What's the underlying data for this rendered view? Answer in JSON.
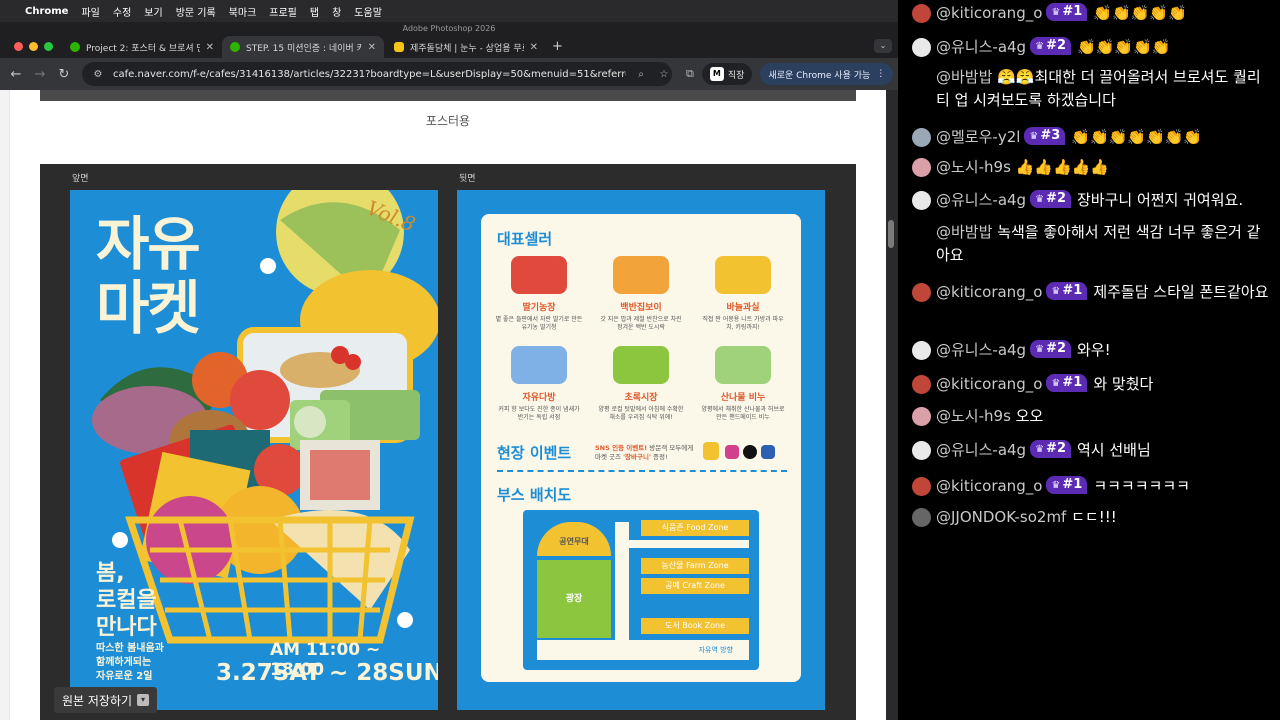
{
  "menubar": {
    "apple": "",
    "app": "Chrome",
    "items": [
      "파일",
      "수정",
      "보기",
      "방문 기록",
      "북마크",
      "프로필",
      "탭",
      "창",
      "도움말"
    ]
  },
  "ps_title": "Adobe Photoshop 2026",
  "tabs": [
    {
      "title": "Project 2: 포스터 & 브로셔 만들기",
      "active": false
    },
    {
      "title": "STEP. 15 미션인증 : 네이버 카페",
      "active": true
    },
    {
      "title": "제주돌담체 | 눈누 - 상업용 무료 한",
      "active": false
    }
  ],
  "toolbar": {
    "url": "cafe.naver.com/f-e/cafes/31416138/articles/32231?boardtype=L&userDisplay=50&menuid=51&referrerAllArticles...",
    "profile_label": "직장",
    "profile_badge": "M",
    "chrome_btn": "새로운 Chrome 사용 가능"
  },
  "page": {
    "caption": "포스터용",
    "front_label": "앞면",
    "back_label": "뒷면",
    "save_button": "원본 저장하기"
  },
  "poster_front": {
    "title_line1": "자유",
    "title_line2": "마켓",
    "vol": "Vol.8",
    "spring_line1": "봄,",
    "spring_line2": "로컬을",
    "spring_line3": "만나다",
    "sub_line1": "따스한 봄내음과",
    "sub_line2": "함께하게되는",
    "sub_line3": "자유로운 2일",
    "time": "AM 11:00 ~ 18:00",
    "date": "3.27SAT ~ 28SUN"
  },
  "poster_back": {
    "seller_heading": "대표셀러",
    "sellers": [
      {
        "name": "딸기농장",
        "desc": "볕 좋은 들판에서 자란 딸기로 만든 유기농 딸기청",
        "color": "#e04a3c"
      },
      {
        "name": "백반집보이",
        "desc": "갓 지은 밥과 제철 반찬으로 차린 정겨운 백반 도시락",
        "color": "#f2a33a"
      },
      {
        "name": "바늘과실",
        "desc": "직접 짠 어몽용 니트 가방과 파우치, 키링까지!",
        "color": "#f2c231"
      },
      {
        "name": "자유다방",
        "desc": "커피 향 보다도 진한 종이 냄새가 반기는 독립 서점",
        "color": "#7fb0e6"
      },
      {
        "name": "초록시장",
        "desc": "양평 로컬 텃밭에서 아침에 수확한 채소를 우리집 식탁 위에!",
        "color": "#8cc63f"
      },
      {
        "name": "산나물 비누",
        "desc": "양평에서 채취한 산나물과 허브로 만든 핸드메이드 비누",
        "color": "#9fd27a"
      }
    ],
    "event_heading": "현장 이벤트",
    "event_text_pre": "SNS 인증 이벤트!",
    "event_text_mid": " 방문객 모두에게 마켓 굿즈 ",
    "event_text_hl": "'장바구니'",
    "event_text_post": " 증정!",
    "map_heading": "부스 배치도",
    "stage": "공연무대",
    "plaza": "광장",
    "zones": [
      "식품존 Food Zone",
      "농산물 Farm Zone",
      "공예 Craft Zone",
      "도서 Book Zone"
    ],
    "exit": "자유역 방향"
  },
  "chat": [
    {
      "user": "@kiticorang_o",
      "rank": "#1",
      "text": "👏👏👏👏👏",
      "av": "#c0463a"
    },
    {
      "user": "@유니스-a4g",
      "rank": "#2",
      "text": "👏👏👏👏👏",
      "av": "#e9e9e9"
    },
    {
      "user": "@바밤밥",
      "rank": "",
      "text": "😤😤최대한 더 끌어올려서 브로셔도 퀄리티 업 시켜보도록 하겠습니다",
      "av": "#000000"
    },
    {
      "user": "@멜로우-y2l",
      "rank": "#3",
      "text": "👏👏👏👏👏👏👏",
      "av": "#9aa7b5"
    },
    {
      "user": "@노시-h9s",
      "rank": "",
      "text": "👍👍👍👍👍",
      "av": "#d9a0a8"
    },
    {
      "user": "@유니스-a4g",
      "rank": "#2",
      "text": "장바구니 어쩐지 귀여워요.",
      "av": "#e9e9e9"
    },
    {
      "user": "@바밤밥",
      "rank": "",
      "text": "녹색을 좋아해서 저런 색감 너무 좋은거 같아요",
      "av": "#000000"
    },
    {
      "user": "@kiticorang_o",
      "rank": "#1",
      "text": "제주돌담 스타일 폰트같아요",
      "av": "#c0463a"
    },
    {
      "user": "@유니스-a4g",
      "rank": "#2",
      "text": "와우!",
      "av": "#e9e9e9"
    },
    {
      "user": "@kiticorang_o",
      "rank": "#1",
      "text": "와 맞췄다",
      "av": "#c0463a"
    },
    {
      "user": "@노시-h9s",
      "rank": "",
      "text": "오오",
      "av": "#d9a0a8"
    },
    {
      "user": "@유니스-a4g",
      "rank": "#2",
      "text": "역시 선배님",
      "av": "#e9e9e9"
    },
    {
      "user": "@kiticorang_o",
      "rank": "#1",
      "text": "ㅋㅋㅋㅋㅋㅋㅋ",
      "av": "#c0463a"
    },
    {
      "user": "@JJONDOK-so2mf",
      "rank": "",
      "text": "ㄷㄷ!!!",
      "av": "#666666"
    }
  ]
}
